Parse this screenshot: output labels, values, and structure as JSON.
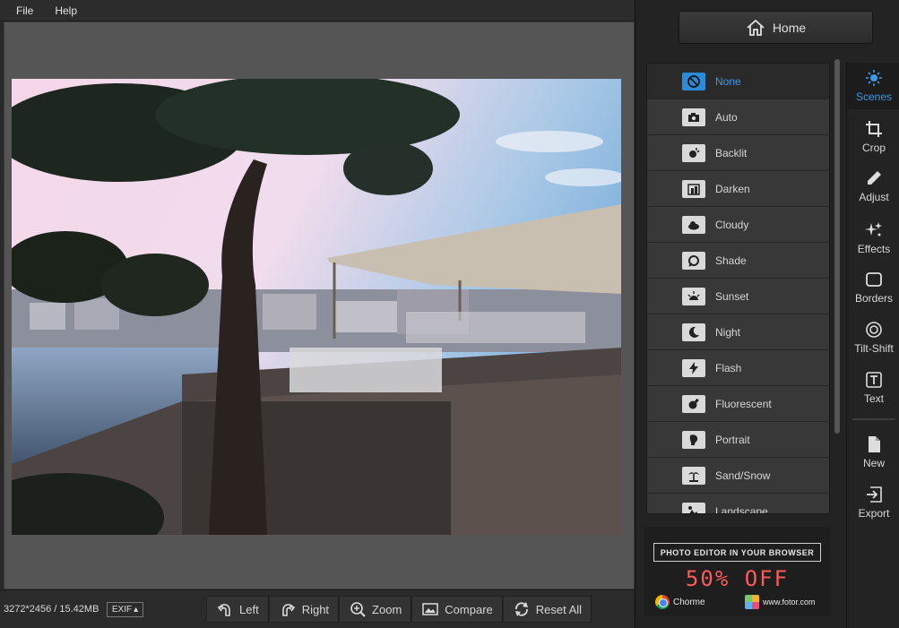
{
  "menu": {
    "items": [
      "File",
      "Help"
    ]
  },
  "status": {
    "size_info": "3272*2456 / 15.42MB",
    "exif_label": "EXIF"
  },
  "toolbar": {
    "left_label": "Left",
    "right_label": "Right",
    "zoom_label": "Zoom",
    "compare_label": "Compare",
    "reset_label": "Reset All"
  },
  "home": {
    "label": "Home"
  },
  "scenes": {
    "items": [
      {
        "label": "None",
        "icon": "none-icon",
        "active": true
      },
      {
        "label": "Auto",
        "icon": "camera-icon"
      },
      {
        "label": "Backlit",
        "icon": "backlit-icon"
      },
      {
        "label": "Darken",
        "icon": "darken-icon"
      },
      {
        "label": "Cloudy",
        "icon": "cloud-icon"
      },
      {
        "label": "Shade",
        "icon": "shade-icon"
      },
      {
        "label": "Sunset",
        "icon": "sunset-icon"
      },
      {
        "label": "Night",
        "icon": "moon-icon"
      },
      {
        "label": "Flash",
        "icon": "flash-icon"
      },
      {
        "label": "Fluorescent",
        "icon": "bulb-icon"
      },
      {
        "label": "Portrait",
        "icon": "portrait-icon"
      },
      {
        "label": "Sand/Snow",
        "icon": "palm-icon"
      },
      {
        "label": "Landscape",
        "icon": "landscape-icon"
      }
    ]
  },
  "tools": {
    "scenes": "Scenes",
    "crop": "Crop",
    "adjust": "Adjust",
    "effects": "Effects",
    "borders": "Borders",
    "tiltshift": "Tilt-Shift",
    "text": "Text",
    "new": "New",
    "export": "Export"
  },
  "ad": {
    "title": "PHOTO EDITOR IN YOUR BROWSER",
    "offer": "50% OFF",
    "chrome": "Chorme",
    "site": "www.fotor.com"
  },
  "colors": {
    "accent": "#3a9ae8",
    "offer": "#ff5a5a"
  }
}
